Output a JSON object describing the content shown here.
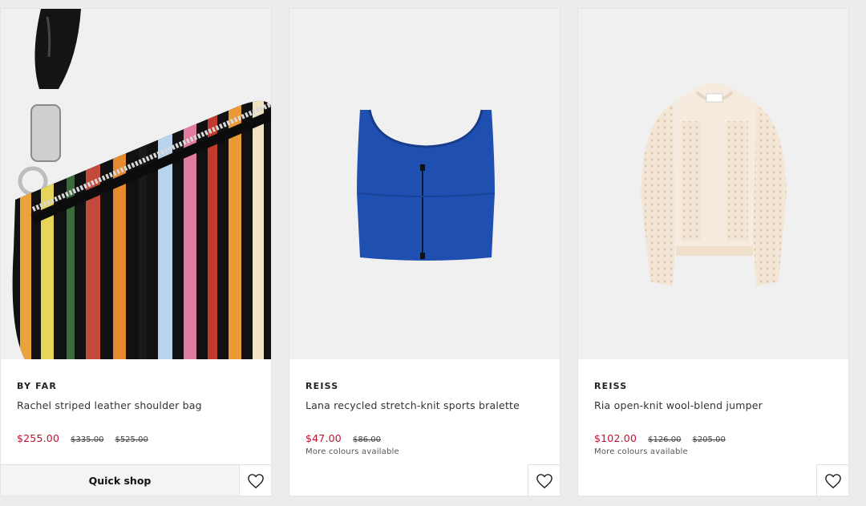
{
  "products": [
    {
      "brand": "BY FAR",
      "name": "Rachel striped leather shoulder bag",
      "price_now": "$255.00",
      "prices_was": [
        "$335.00",
        "$525.00"
      ],
      "more_colours": "",
      "quick_shop_label": "Quick shop",
      "image_icon": "striped-shoulder-bag-image"
    },
    {
      "brand": "REISS",
      "name": "Lana recycled stretch-knit sports bralette",
      "price_now": "$47.00",
      "prices_was": [
        "$86.00"
      ],
      "more_colours": "More colours available",
      "image_icon": "blue-bralette-image"
    },
    {
      "brand": "REISS",
      "name": "Ria open-knit wool-blend jumper",
      "price_now": "$102.00",
      "prices_was": [
        "$126.00",
        "$205.00"
      ],
      "more_colours": "More colours available",
      "image_icon": "cream-jumper-image"
    }
  ],
  "colors": {
    "sale_price": "#c8102e",
    "image_background": "#f1f0f1",
    "page_background": "#ececec"
  },
  "icons": {
    "wishlist": "heart-outline-icon"
  }
}
